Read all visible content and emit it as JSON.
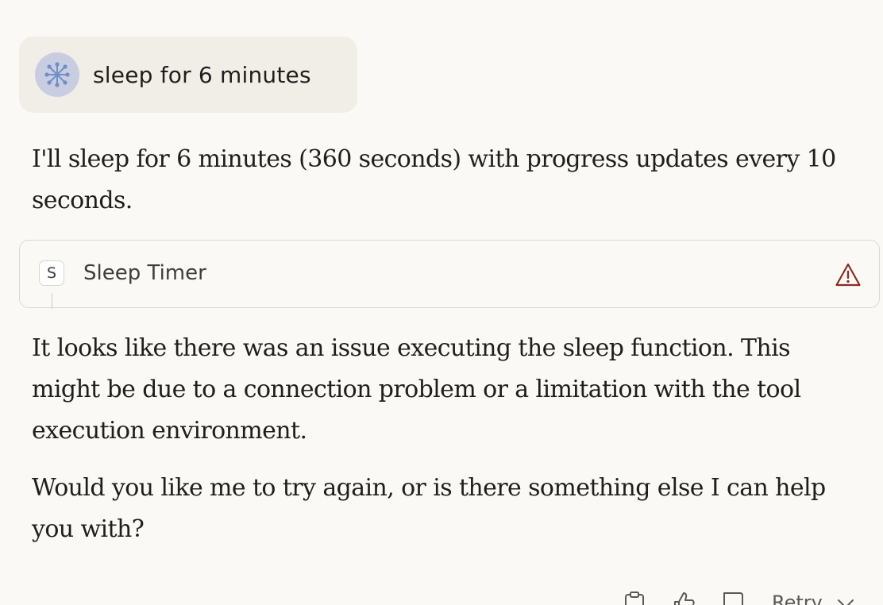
{
  "user_message": {
    "avatar_icon": "network-node-icon",
    "text": "sleep for 6 minutes"
  },
  "assistant": {
    "intro": "I'll sleep for 6 minutes (360 seconds) with progress updates every 10 seconds.",
    "tool_call": {
      "badge": "S",
      "name": "Sleep Timer",
      "status_icon": "warning-icon",
      "status_color": "#8a2c22"
    },
    "error_text": "It looks like there was an issue executing the sleep function. This might be due to a connection problem or a limitation with the tool execution environment.",
    "followup": "Would you like me to try again, or is there something else I can help you with?"
  },
  "actions": {
    "icons": [
      "clipboard-icon",
      "thumbs-up-icon",
      "thumbs-down-icon"
    ],
    "retry_label": "Retry",
    "retry_icon": "chevron-down-icon"
  }
}
